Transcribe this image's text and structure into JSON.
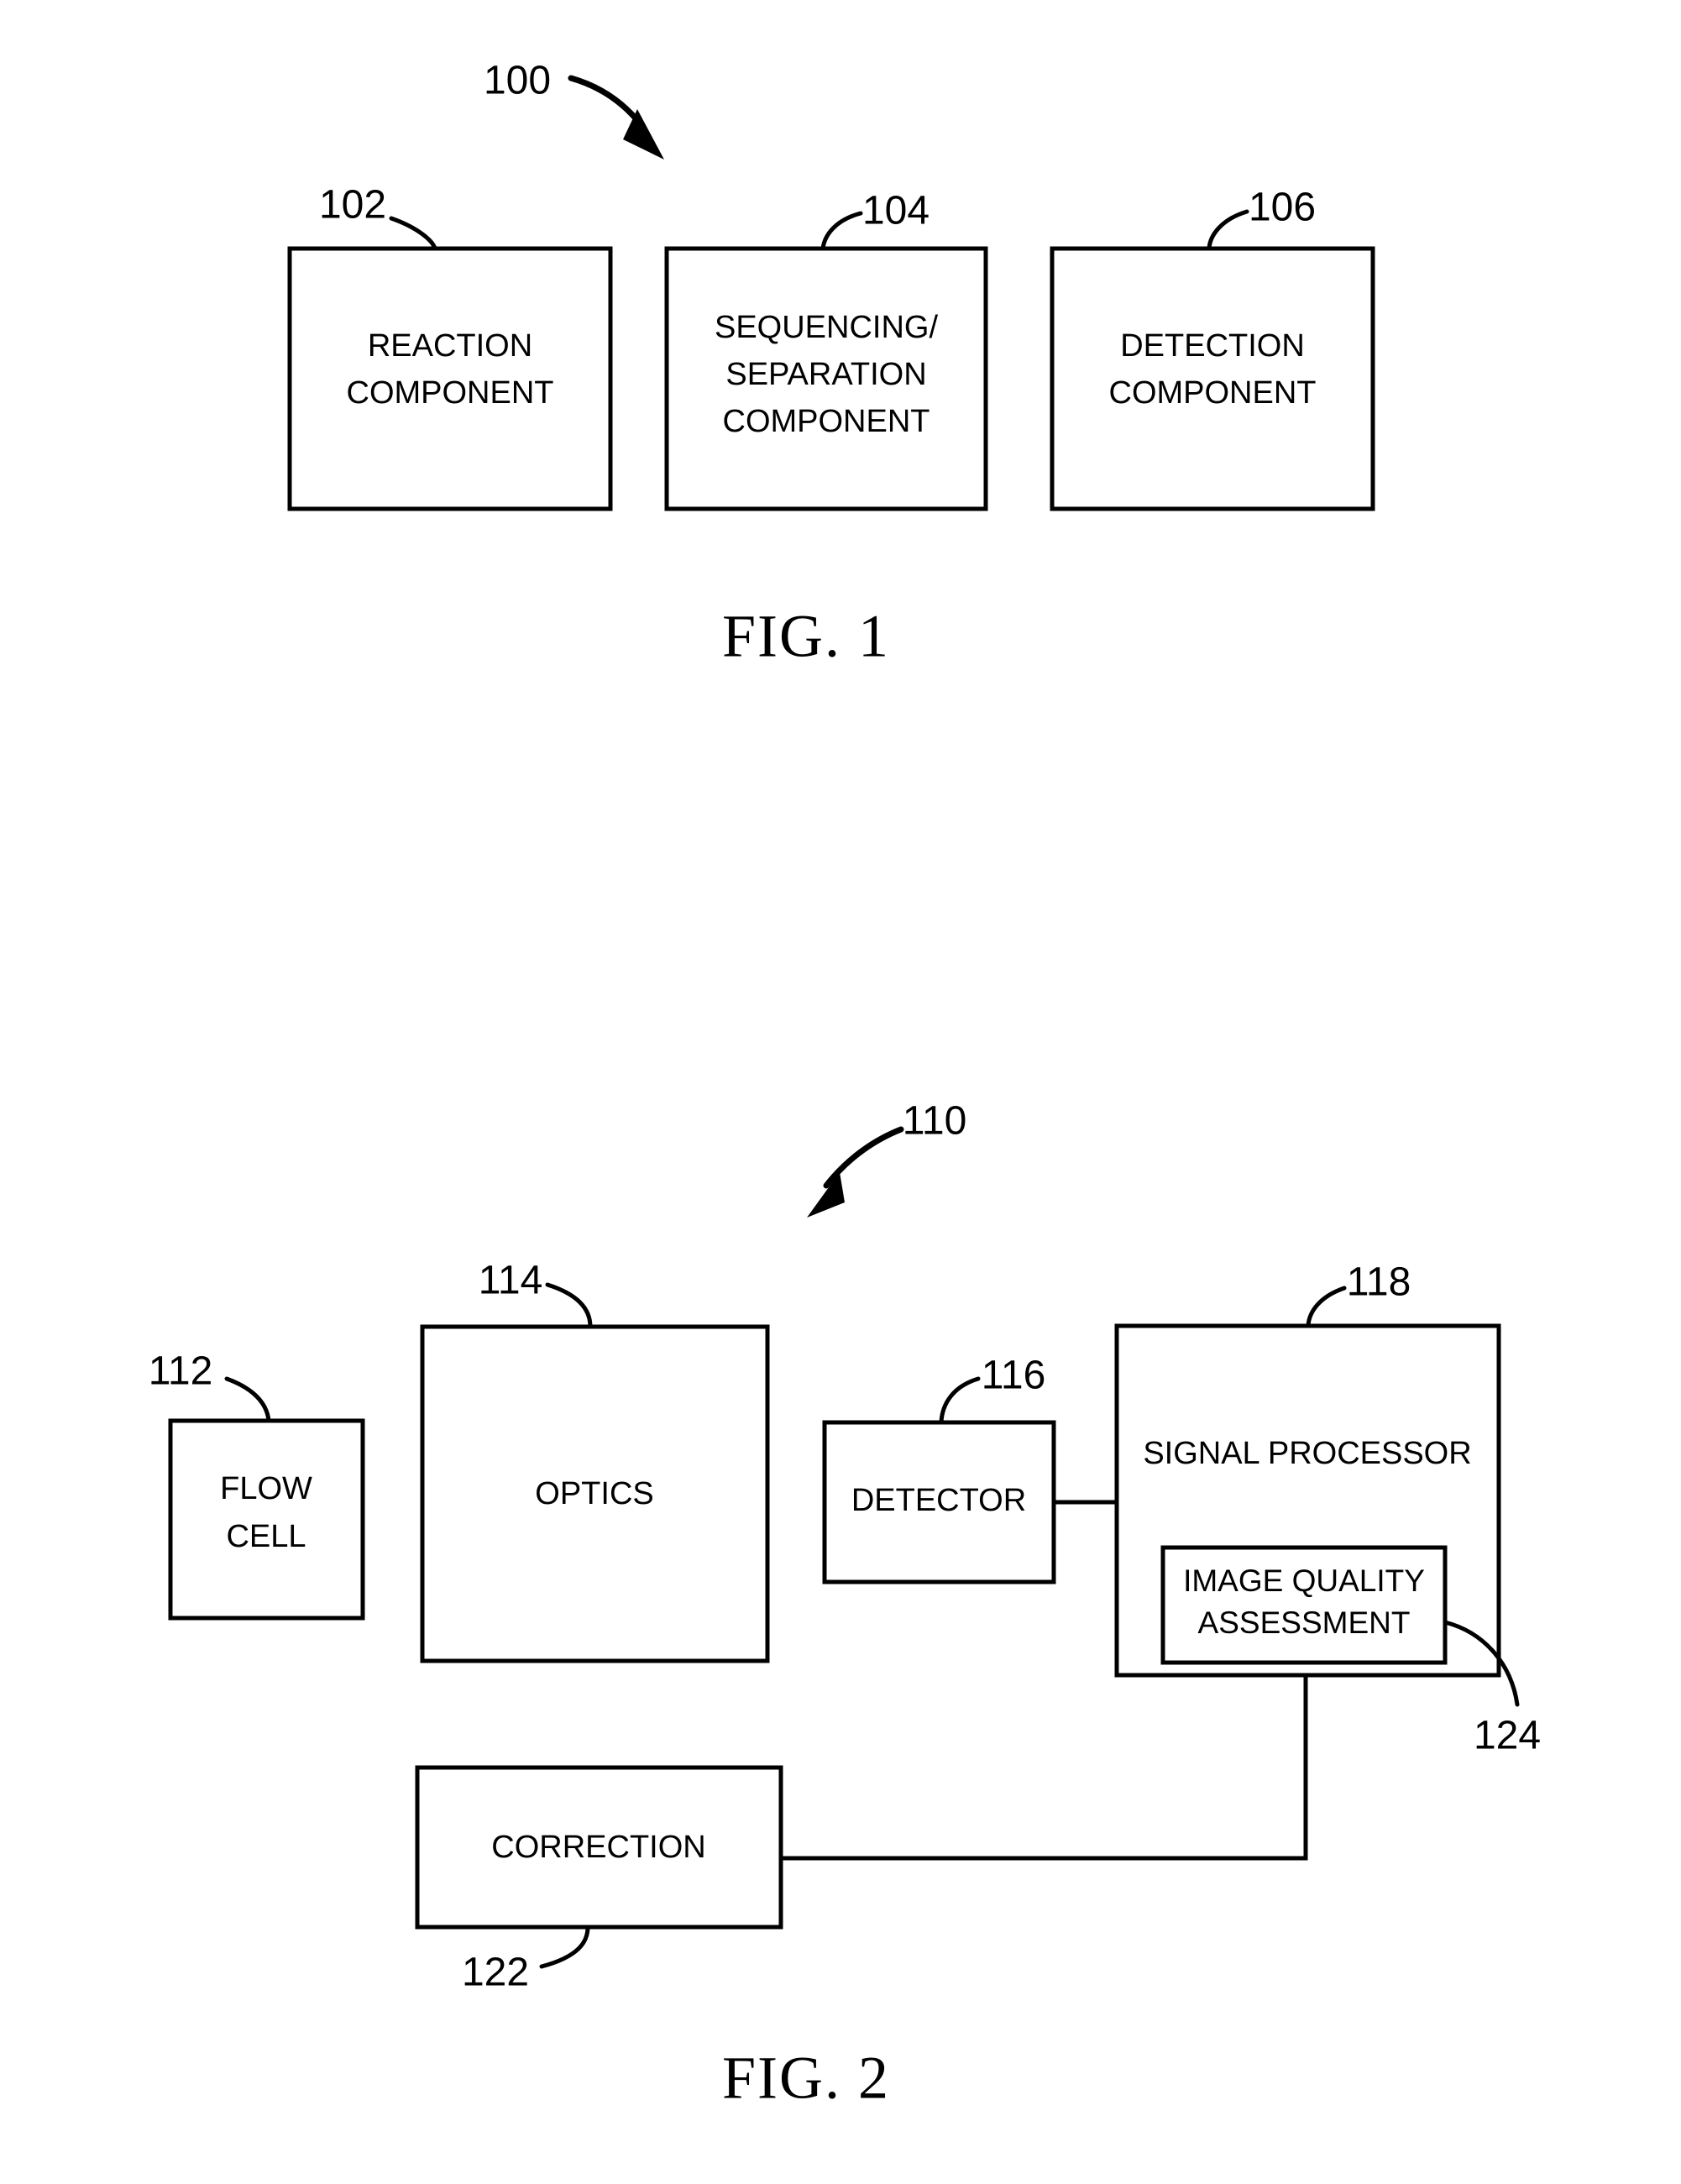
{
  "document": {
    "type": "patent-figure-sheet",
    "background_color": "#ffffff",
    "line_color": "#000000"
  },
  "figures": [
    {
      "id": "figure-1",
      "caption": "FIG. 1",
      "reference_numeral": "100",
      "boxes": [
        {
          "ref": "102",
          "label_lines": [
            "REACTION",
            "COMPONENT"
          ]
        },
        {
          "ref": "104",
          "label_lines": [
            "SEQUENCING/",
            "SEPARATION",
            "COMPONENT"
          ]
        },
        {
          "ref": "106",
          "label_lines": [
            "DETECTION",
            "COMPONENT"
          ]
        }
      ]
    },
    {
      "id": "figure-2",
      "caption": "FIG. 2",
      "reference_numeral": "110",
      "boxes": [
        {
          "ref": "112",
          "label_lines": [
            "FLOW",
            "CELL"
          ]
        },
        {
          "ref": "114",
          "label_lines": [
            "OPTICS"
          ]
        },
        {
          "ref": "116",
          "label_lines": [
            "DETECTOR"
          ]
        },
        {
          "ref": "118",
          "label_lines": [
            "SIGNAL PROCESSOR"
          ]
        },
        {
          "ref": "124",
          "label_lines": [
            "IMAGE QUALITY",
            "ASSESSMENT"
          ]
        },
        {
          "ref": "122",
          "label_lines": [
            "CORRECTION"
          ]
        }
      ]
    }
  ],
  "fig1": {
    "numeral_100": "100",
    "caption": "FIG. 1",
    "box102": {
      "ref": "102",
      "line1": "REACTION",
      "line2": "COMPONENT"
    },
    "box104": {
      "ref": "104",
      "line1": "SEQUENCING/",
      "line2": "SEPARATION",
      "line3": "COMPONENT"
    },
    "box106": {
      "ref": "106",
      "line1": "DETECTION",
      "line2": "COMPONENT"
    }
  },
  "fig2": {
    "numeral_110": "110",
    "caption": "FIG. 2",
    "box112": {
      "ref": "112",
      "line1": "FLOW",
      "line2": "CELL"
    },
    "box114": {
      "ref": "114",
      "line1": "OPTICS"
    },
    "box116": {
      "ref": "116",
      "line1": "DETECTOR"
    },
    "box118": {
      "ref": "118",
      "line1": "SIGNAL PROCESSOR"
    },
    "box124": {
      "ref": "124",
      "line1": "IMAGE QUALITY",
      "line2": "ASSESSMENT"
    },
    "box122": {
      "ref": "122",
      "line1": "CORRECTION"
    }
  }
}
